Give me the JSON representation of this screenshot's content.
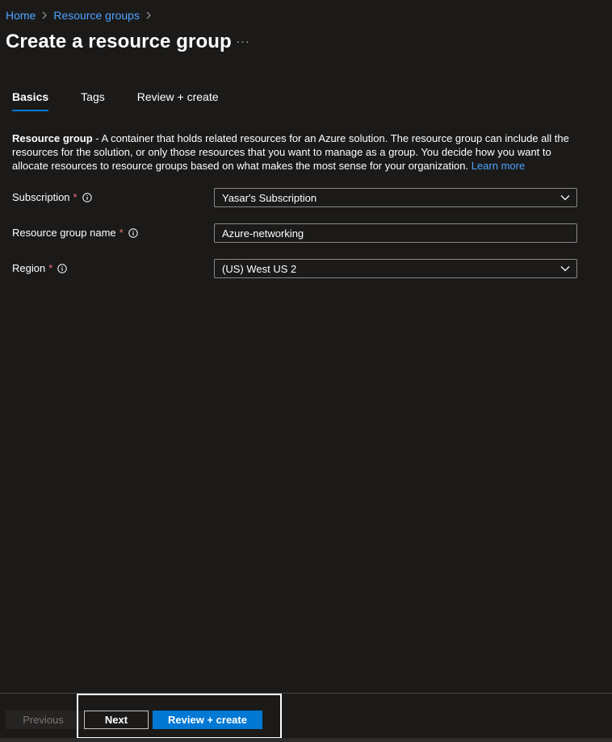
{
  "breadcrumb": {
    "items": [
      "Home",
      "Resource groups"
    ]
  },
  "page": {
    "title": "Create a resource group",
    "more_label": "···"
  },
  "tabs": [
    {
      "label": "Basics",
      "active": true
    },
    {
      "label": "Tags",
      "active": false
    },
    {
      "label": "Review + create",
      "active": false
    }
  ],
  "description": {
    "bold": "Resource group",
    "text": " - A container that holds related resources for an Azure solution. The resource group can include all the resources for the solution, or only those resources that you want to manage as a group. You decide how you want to allocate resources to resource groups based on what makes the most sense for your organization.",
    "link": "Learn more"
  },
  "form": {
    "subscription": {
      "label": "Subscription",
      "required_mark": "*",
      "value": "Yasar's Subscription"
    },
    "resource_group_name": {
      "label": "Resource group name",
      "required_mark": "*",
      "value": "Azure-networking"
    },
    "region": {
      "label": "Region",
      "required_mark": "*",
      "value": "(US) West US 2"
    }
  },
  "footer": {
    "previous_label": "Previous",
    "next_label": "Next",
    "review_label": "Review + create"
  },
  "colors": {
    "background": "#1b1a19",
    "accent": "#0078d4",
    "link": "#4da3ff",
    "required": "#f1707b"
  },
  "icons": [
    "chevron-right-icon",
    "more-icon",
    "info-icon",
    "chevron-down-icon"
  ]
}
